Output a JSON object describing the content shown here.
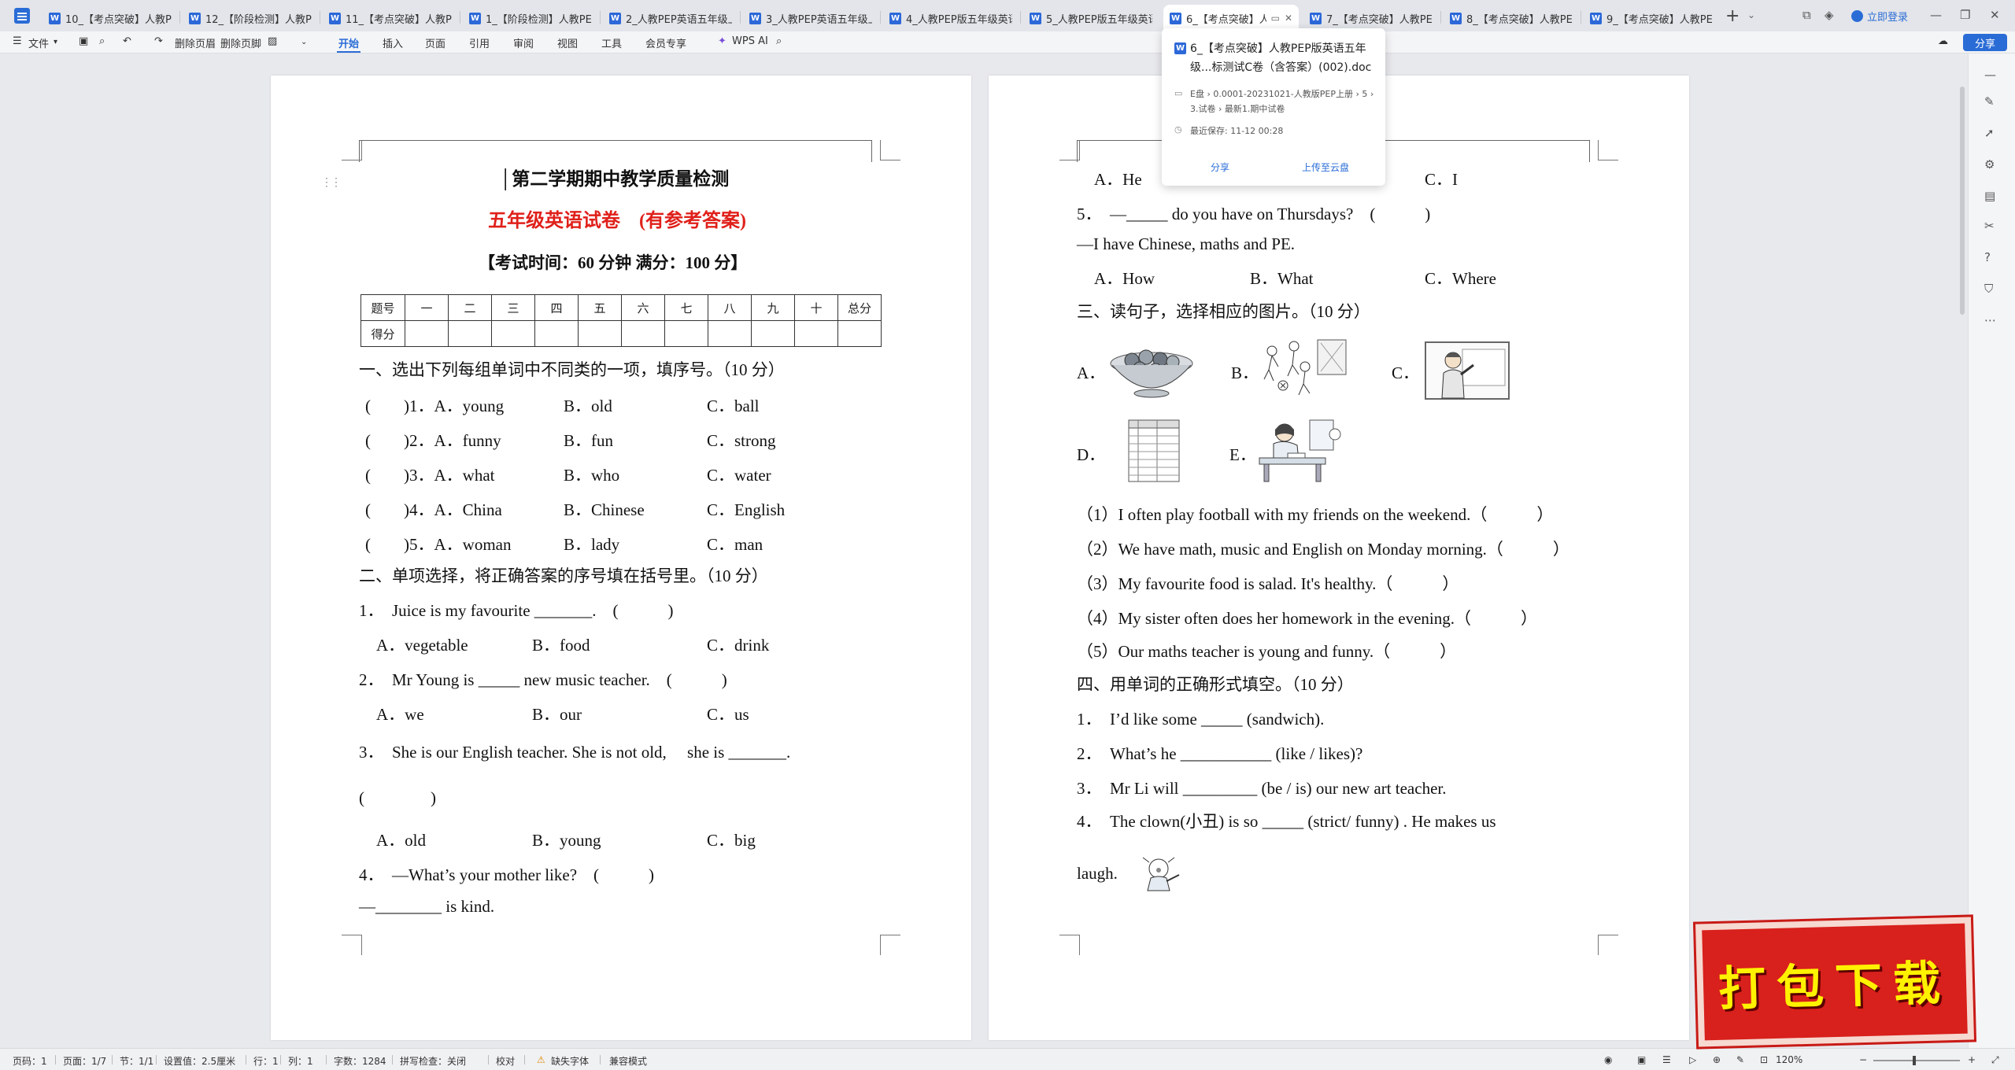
{
  "tabs": [
    {
      "label": "10_【考点突破】人教PEP"
    },
    {
      "label": "12_【阶段检测】人教PEP"
    },
    {
      "label": "11_【考点突破】人教PEP"
    },
    {
      "label": "1_【阶段检测】人教PEP"
    },
    {
      "label": "2_人教PEP英语五年级上"
    },
    {
      "label": "3_人教PEP英语五年级上"
    },
    {
      "label": "4_人教PEP版五年级英语"
    },
    {
      "label": "5_人教PEP版五年级英语"
    },
    {
      "label": "6_【考点突破】人"
    },
    {
      "label": "7_【考点突破】人教PEP"
    },
    {
      "label": "8_【考点突破】人教PEP"
    },
    {
      "label": "9_【考点突破】人教PEP"
    }
  ],
  "titlebar": {
    "login": "立即登录",
    "new_tab": "+"
  },
  "ribbon": {
    "file": "文件",
    "items": [
      "删除页眉",
      "删除页脚"
    ],
    "tabs": [
      "开始",
      "插入",
      "页面",
      "引用",
      "审阅",
      "视图",
      "工具",
      "会员专享"
    ],
    "wps_ai": "WPS AI",
    "share": "分享"
  },
  "popup": {
    "filename": "6_【考点突破】人教PEP版英语五年级...标测试C卷（含答案）(002).doc",
    "path": "E盘 › 0.0001-20231021-人教版PEP上册 › 5 › 3.试卷 › 最新1.期中试卷",
    "saved": "最近保存: 11-12 00:28",
    "share": "分享",
    "upload": "上传至云盘"
  },
  "page1": {
    "title": "第二学期期中教学质量检测",
    "subtitle": "五年级英语试卷　(有参考答案)",
    "exam_info": "【考试时间：60 分钟  满分：100 分】",
    "score_header": [
      "题号",
      "一",
      "二",
      "三",
      "四",
      "五",
      "六",
      "七",
      "八",
      "九",
      "十",
      "总分"
    ],
    "score_row_label": "得分",
    "s1": "一、选出下列每组单词中不同类的一项，填序号。（10 分）",
    "q1": [
      {
        "num": "(　　)1．A．young",
        "b": "B．old",
        "c": "C．ball"
      },
      {
        "num": "(　　)2．A．funny",
        "b": "B．fun",
        "c": "C．strong"
      },
      {
        "num": "(　　)3．A．what",
        "b": "B．who",
        "c": "C．water"
      },
      {
        "num": "(　　)4．A．China",
        "b": "B．Chinese",
        "c": "C．English"
      },
      {
        "num": "(　　)5．A．woman",
        "b": "B．lady",
        "c": "C．man"
      }
    ],
    "s2": "二、单项选择，将正确答案的序号填在括号里。（10 分）",
    "q2_1": "1．　Juice is my favourite _______.　(　　　)",
    "q2_1_opts": [
      "A．vegetable",
      "B．food",
      "C．drink"
    ],
    "q2_2": "2．　Mr Young is _____ new music teacher.　(　　　)",
    "q2_2_opts": [
      "A．we",
      "B．our",
      "C．us"
    ],
    "q2_3": "3．　She is our English teacher. She is not old,　 she is _______.",
    "q2_3_paren": "(　　　　)",
    "q2_3_opts": [
      "A．old",
      "B．young",
      "C．big"
    ],
    "q2_4": "4．　—What’s your mother like?　(　　　)",
    "q2_4_ans": "—________ is kind."
  },
  "page2": {
    "top_a": "A．He",
    "top_c": "C．I",
    "q5": "5．　—_____ do you have on Thursdays?　(　　　)",
    "q5_ans": "—I have Chinese, maths and PE.",
    "q5_opts": [
      "A．How",
      "B．What",
      "C．Where"
    ],
    "s3": "三、读句子，选择相应的图片。（10 分）",
    "pic_labels": [
      "A．",
      "B．",
      "C．",
      "D．",
      "E．"
    ],
    "s3_items": [
      "（1）I often play football with my friends on the weekend.（　　　）",
      "（2）We have math, music and English on Monday morning.（　　　）",
      "（3）My favourite food is salad. It's healthy.（　　　）",
      "（4）My sister often does her homework in the evening.（　　　）",
      "（5）Our maths teacher is young and funny.（　　　）"
    ],
    "s4": "四、用单词的正确形式填空。（10 分）",
    "s4_items": [
      "1．　I’d like some _____ (sandwich).",
      "2．　What’s he ___________ (like / likes)?",
      "3．　Mr Li will _________ (be / is) our new art teacher.",
      "4．　The clown(小丑) is so _____ (strict/ funny) . He makes us"
    ],
    "s4_tail": "laugh."
  },
  "statusbar": {
    "page_no": "页码：1",
    "pages": "页面：1/7",
    "section": "节：1/1",
    "setting": "设置值：2.5厘米",
    "row": "行：1",
    "col": "列：1",
    "words": "字数：1284",
    "spell": "拼写检查：关闭",
    "proof": "校对",
    "missing_font": "缺失字体",
    "compat": "兼容模式",
    "zoom": "120%"
  },
  "download_badge": "打包下载",
  "colors": {
    "accent": "#2a6cd6",
    "title_red": "#e0201a",
    "badge_red": "#d8201c"
  }
}
